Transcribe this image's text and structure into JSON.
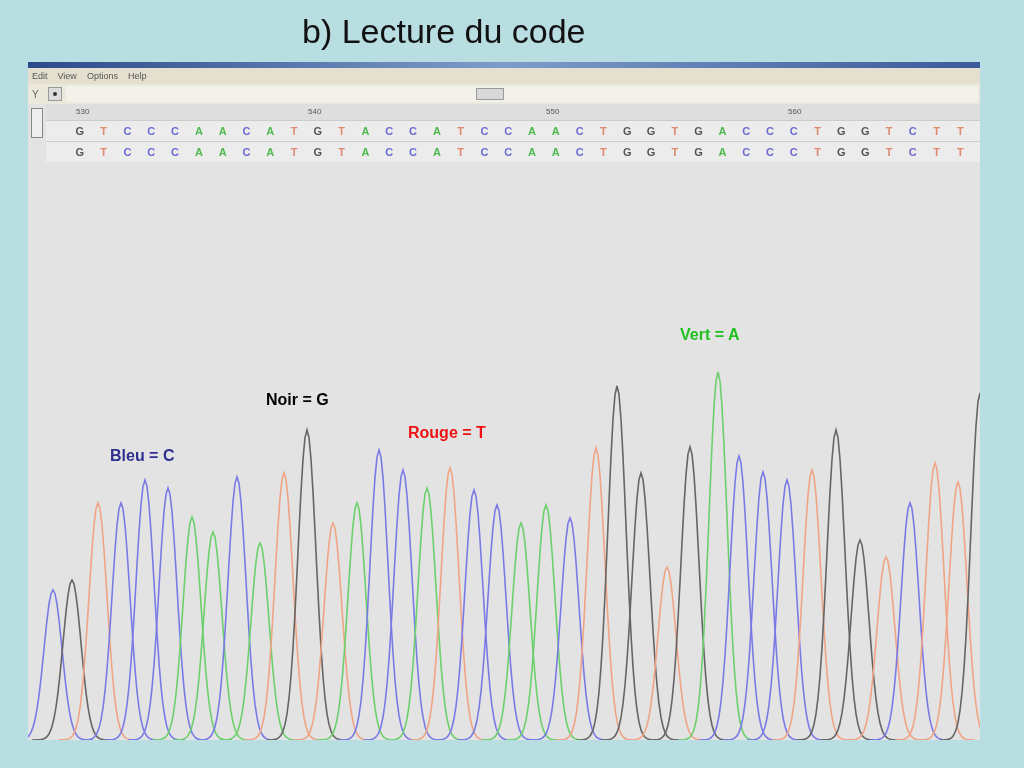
{
  "slide_title": "b) Lecture du code",
  "window": {
    "menu": [
      "Edit",
      "View",
      "Options",
      "Help"
    ],
    "toolbar": {
      "label": "Y"
    },
    "ruler": [
      "530",
      "540",
      "550",
      "560"
    ],
    "base_rows": [
      {
        "bases": [
          {
            "base": "G",
            "color": "#555555"
          },
          {
            "base": "T",
            "color": "#e08870"
          },
          {
            "base": "C",
            "color": "#6a6ad0"
          },
          {
            "base": "C",
            "color": "#6a6ad0"
          },
          {
            "base": "C",
            "color": "#6a6ad0"
          },
          {
            "base": "A",
            "color": "#50b850"
          },
          {
            "base": "A",
            "color": "#50b850"
          },
          {
            "base": "C",
            "color": "#6a6ad0"
          },
          {
            "base": "A",
            "color": "#50b850"
          },
          {
            "base": "T",
            "color": "#e08870"
          },
          {
            "base": "G",
            "color": "#555555"
          },
          {
            "base": "T",
            "color": "#e08870"
          },
          {
            "base": "A",
            "color": "#50b850"
          },
          {
            "base": "C",
            "color": "#6a6ad0"
          },
          {
            "base": "C",
            "color": "#6a6ad0"
          },
          {
            "base": "A",
            "color": "#50b850"
          },
          {
            "base": "T",
            "color": "#e08870"
          },
          {
            "base": "C",
            "color": "#6a6ad0"
          },
          {
            "base": "C",
            "color": "#6a6ad0"
          },
          {
            "base": "A",
            "color": "#50b850"
          },
          {
            "base": "A",
            "color": "#50b850"
          },
          {
            "base": "C",
            "color": "#6a6ad0"
          },
          {
            "base": "T",
            "color": "#e08870"
          },
          {
            "base": "G",
            "color": "#555555"
          },
          {
            "base": "G",
            "color": "#555555"
          },
          {
            "base": "T",
            "color": "#e08870"
          },
          {
            "base": "G",
            "color": "#555555"
          },
          {
            "base": "A",
            "color": "#50b850"
          },
          {
            "base": "C",
            "color": "#6a6ad0"
          },
          {
            "base": "C",
            "color": "#6a6ad0"
          },
          {
            "base": "C",
            "color": "#6a6ad0"
          },
          {
            "base": "T",
            "color": "#e08870"
          },
          {
            "base": "G",
            "color": "#555555"
          },
          {
            "base": "G",
            "color": "#555555"
          },
          {
            "base": "T",
            "color": "#e08870"
          },
          {
            "base": "C",
            "color": "#6a6ad0"
          },
          {
            "base": "T",
            "color": "#e08870"
          },
          {
            "base": "T",
            "color": "#e08870"
          }
        ]
      },
      {
        "bases": [
          {
            "base": "G",
            "color": "#555555"
          },
          {
            "base": "T",
            "color": "#e08870"
          },
          {
            "base": "C",
            "color": "#6a6ad0"
          },
          {
            "base": "C",
            "color": "#6a6ad0"
          },
          {
            "base": "C",
            "color": "#6a6ad0"
          },
          {
            "base": "A",
            "color": "#50b850"
          },
          {
            "base": "A",
            "color": "#50b850"
          },
          {
            "base": "C",
            "color": "#6a6ad0"
          },
          {
            "base": "A",
            "color": "#50b850"
          },
          {
            "base": "T",
            "color": "#e08870"
          },
          {
            "base": "G",
            "color": "#555555"
          },
          {
            "base": "T",
            "color": "#e08870"
          },
          {
            "base": "A",
            "color": "#50b850"
          },
          {
            "base": "C",
            "color": "#6a6ad0"
          },
          {
            "base": "C",
            "color": "#6a6ad0"
          },
          {
            "base": "A",
            "color": "#50b850"
          },
          {
            "base": "T",
            "color": "#e08870"
          },
          {
            "base": "C",
            "color": "#6a6ad0"
          },
          {
            "base": "C",
            "color": "#6a6ad0"
          },
          {
            "base": "A",
            "color": "#50b850"
          },
          {
            "base": "A",
            "color": "#50b850"
          },
          {
            "base": "C",
            "color": "#6a6ad0"
          },
          {
            "base": "T",
            "color": "#e08870"
          },
          {
            "base": "G",
            "color": "#555555"
          },
          {
            "base": "G",
            "color": "#555555"
          },
          {
            "base": "T",
            "color": "#e08870"
          },
          {
            "base": "G",
            "color": "#555555"
          },
          {
            "base": "A",
            "color": "#50b850"
          },
          {
            "base": "C",
            "color": "#6a6ad0"
          },
          {
            "base": "C",
            "color": "#6a6ad0"
          },
          {
            "base": "C",
            "color": "#6a6ad0"
          },
          {
            "base": "T",
            "color": "#e08870"
          },
          {
            "base": "G",
            "color": "#555555"
          },
          {
            "base": "G",
            "color": "#555555"
          },
          {
            "base": "T",
            "color": "#e08870"
          },
          {
            "base": "C",
            "color": "#6a6ad0"
          },
          {
            "base": "T",
            "color": "#e08870"
          },
          {
            "base": "T",
            "color": "#e08870"
          }
        ]
      }
    ],
    "legend": [
      {
        "text": "Vert = A",
        "color": "#20c020"
      },
      {
        "text": "Noir = G",
        "color": "#000000"
      },
      {
        "text": "Rouge = T",
        "color": "#ee1111"
      },
      {
        "text": "Bleu = C",
        "color": "#303090"
      }
    ]
  }
}
